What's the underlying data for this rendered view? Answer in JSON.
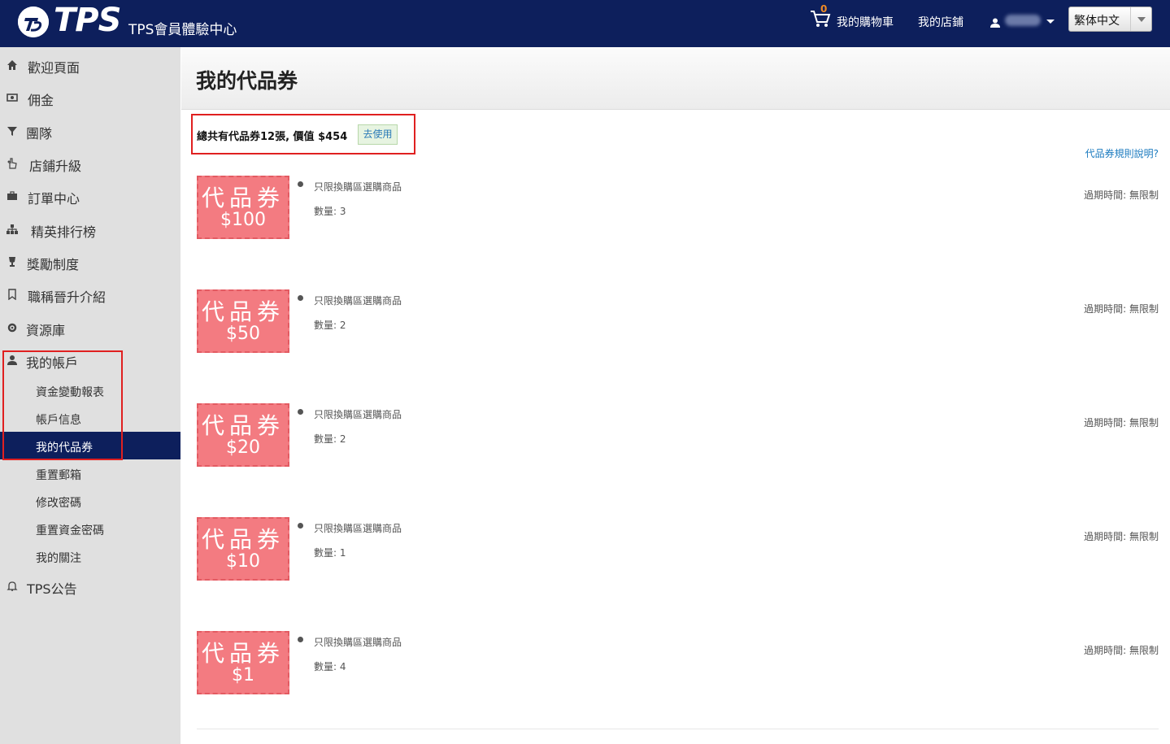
{
  "header": {
    "logo_text": "TPS",
    "subtitle": "TPS會員體驗中心",
    "cart_count": "0",
    "cart_label": "我的購物車",
    "store_label": "我的店鋪",
    "language": "繁体中文"
  },
  "sidebar": {
    "items": [
      {
        "label": "歡迎頁面",
        "icon": "home-icon"
      },
      {
        "label": "佣金",
        "icon": "money-icon"
      },
      {
        "label": "團隊",
        "icon": "filter-icon"
      },
      {
        "label": "店鋪升級",
        "icon": "hand-pointer-icon"
      },
      {
        "label": "訂單中心",
        "icon": "briefcase-icon"
      },
      {
        "label": "精英排行榜",
        "icon": "sitemap-icon"
      },
      {
        "label": "獎勵制度",
        "icon": "trophy-icon"
      },
      {
        "label": "職稱晉升介紹",
        "icon": "bookmark-icon"
      },
      {
        "label": "資源庫",
        "icon": "gear-icon"
      },
      {
        "label": "我的帳戶",
        "icon": "user-icon"
      }
    ],
    "account_sub": [
      {
        "label": "資金變動報表"
      },
      {
        "label": "帳戶信息"
      },
      {
        "label": "我的代品券"
      },
      {
        "label": "重置郵箱"
      },
      {
        "label": "修改密碼"
      },
      {
        "label": "重置資金密碼"
      },
      {
        "label": "我的關注"
      }
    ],
    "announce": {
      "label": "TPS公告",
      "icon": "bell-icon"
    }
  },
  "main": {
    "title": "我的代品券",
    "summary": "總共有代品券12張, 價值 $454",
    "use_button": "去使用",
    "rules_link": "代品券規則說明?",
    "coupons": [
      {
        "word": "代品券",
        "amount": "$100",
        "desc": "只限換購區選購商品",
        "qty": "數量: 3",
        "expire": "過期時間: 無限制"
      },
      {
        "word": "代品券",
        "amount": "$50",
        "desc": "只限換購區選購商品",
        "qty": "數量: 2",
        "expire": "過期時間: 無限制"
      },
      {
        "word": "代品券",
        "amount": "$20",
        "desc": "只限換購區選購商品",
        "qty": "數量: 2",
        "expire": "過期時間: 無限制"
      },
      {
        "word": "代品券",
        "amount": "$10",
        "desc": "只限換購區選購商品",
        "qty": "數量: 1",
        "expire": "過期時間: 無限制"
      },
      {
        "word": "代品券",
        "amount": "$1",
        "desc": "只限換購區選購商品",
        "qty": "數量: 4",
        "expire": "過期時間: 無限制"
      }
    ]
  },
  "colors": {
    "header_bg": "#0d1f5c",
    "coupon_bg": "#f37b81",
    "highlight": "#e02020",
    "link": "#1a7abf"
  }
}
